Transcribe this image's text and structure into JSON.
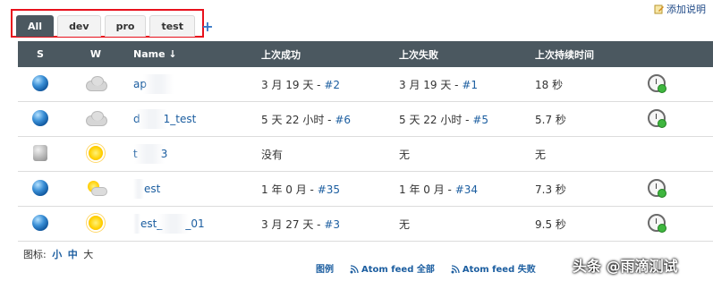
{
  "top_link": {
    "label": "添加说明"
  },
  "tabs": [
    {
      "label": "All",
      "active": true
    },
    {
      "label": "dev",
      "active": false
    },
    {
      "label": "pro",
      "active": false
    },
    {
      "label": "test",
      "active": false
    }
  ],
  "tab_add": "+",
  "table": {
    "headers": {
      "s": "S",
      "w": "W",
      "name": "Name ↓",
      "last_success": "上次成功",
      "last_failure": "上次失败",
      "last_duration": "上次持续时间"
    },
    "rows": [
      {
        "name_prefix": "ap",
        "name_suffix": "",
        "succ_text": "3 月 19 天 - ",
        "succ_build": "#2",
        "fail_text": "3 月 19 天 - ",
        "fail_build": "#1",
        "duration": "18 秒",
        "status": "blue",
        "weather": "cloud",
        "action": true
      },
      {
        "name_prefix": "d",
        "name_suffix": "1_test",
        "succ_text": "5 天 22 小时 - ",
        "succ_build": "#6",
        "fail_text": "5 天 22 小时 - ",
        "fail_build": "#5",
        "duration": "5.7 秒",
        "status": "blue",
        "weather": "cloud",
        "action": true
      },
      {
        "name_prefix": "t",
        "name_suffix": "3",
        "succ_text": "没有",
        "succ_build": "",
        "fail_text": "无",
        "fail_build": "",
        "duration": "无",
        "status": "disabled",
        "weather": "sun",
        "action": false
      },
      {
        "name_prefix": "",
        "name_suffix": "est",
        "succ_text": "1 年 0 月 - ",
        "succ_build": "#35",
        "fail_text": "1 年 0 月 - ",
        "fail_build": "#34",
        "duration": "7.3 秒",
        "status": "blue",
        "weather": "sun-cloud",
        "action": true
      },
      {
        "name_prefix": "",
        "name_suffix": "est_",
        "name_tail": "_01",
        "succ_text": "3 月 27 天 - ",
        "succ_build": "#3",
        "fail_text": "无",
        "fail_build": "",
        "duration": "9.5 秒",
        "status": "blue",
        "weather": "sun",
        "action": true
      }
    ]
  },
  "footer": {
    "label": "图标:",
    "small": "小",
    "medium": "中",
    "large": "大"
  },
  "bottom_links": {
    "legend": "图例",
    "atom_all": "Atom feed 全部",
    "atom_fail": "Atom feed 失败"
  },
  "watermark": "头条 @雨滴测试"
}
